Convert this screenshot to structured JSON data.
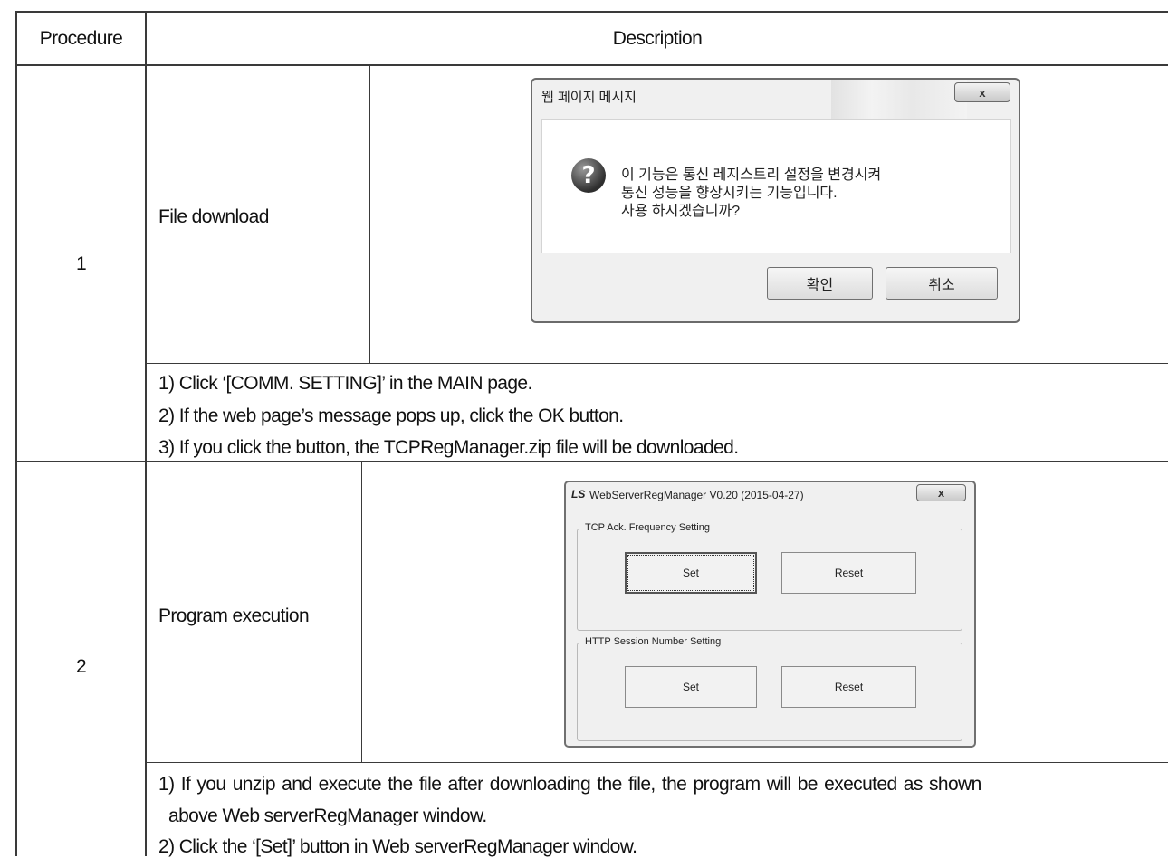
{
  "table": {
    "header": {
      "procedure": "Procedure",
      "description": "Description"
    },
    "rows": [
      {
        "number": "1",
        "label": "File download",
        "steps": [
          "1) Click ‘[COMM. SETTING]’ in the MAIN page.",
          "2) If the web page’s message pops up, click the OK button.",
          "3) If you click the button, the TCPRegManager.zip file will be downloaded."
        ]
      },
      {
        "number": "2",
        "label": "Program execution",
        "steps": [
          "1) If you unzip and execute the file after downloading the file, the program will be executed as shown",
          "above Web serverRegManager window.",
          "2) Click the ‘[Set]’ button in Web serverRegManager window."
        ]
      }
    ]
  },
  "dialog1": {
    "title": "웹 페이지 메시지",
    "close_label": "x",
    "icon": "question-icon",
    "message_lines": [
      "이 기능은 통신 레지스트리 설정을 변경시켜",
      "통신 성능을 향상시키는 기능입니다.",
      "사용 하시겠습니까?"
    ],
    "ok_label": "확인",
    "cancel_label": "취소"
  },
  "dialog2": {
    "logo": "LS",
    "title": "WebServerRegManager V0.20 (2015-04-27)",
    "close_label": "x",
    "groups": [
      {
        "label": "TCP Ack. Frequency Setting",
        "set_label": "Set",
        "reset_label": "Reset"
      },
      {
        "label": "HTTP Session Number Setting",
        "set_label": "Set",
        "reset_label": "Reset"
      }
    ]
  }
}
